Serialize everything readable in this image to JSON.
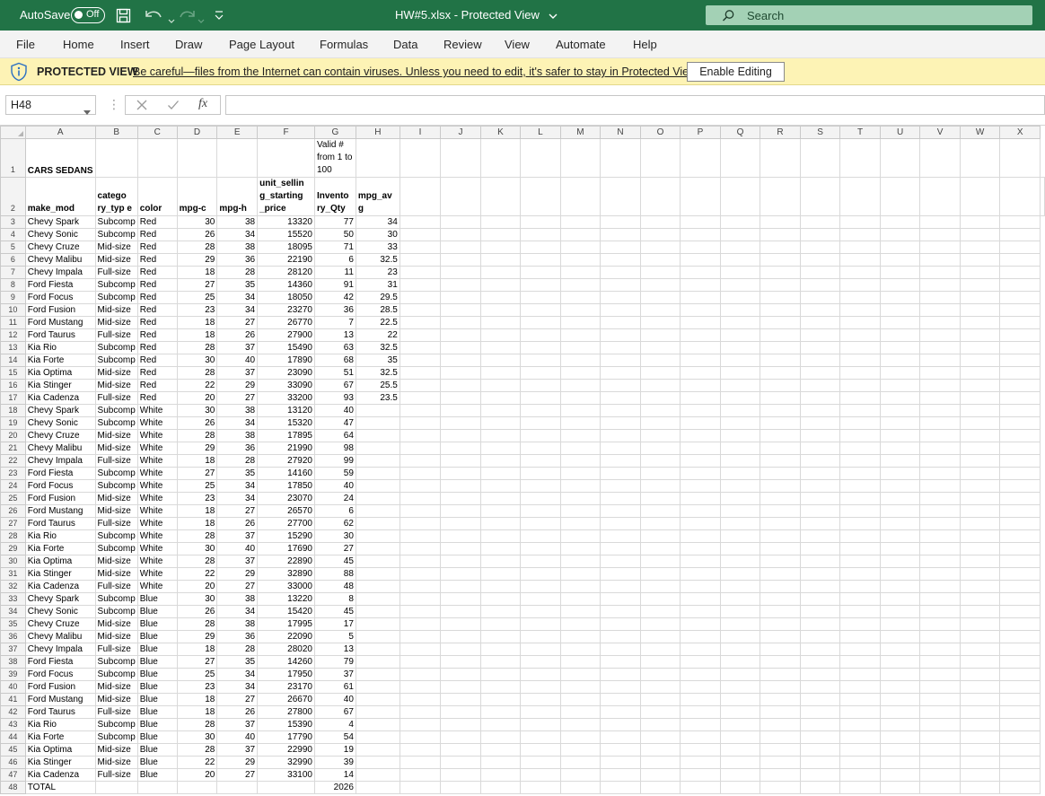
{
  "titlebar": {
    "autosave_label": "AutoSave",
    "autosave_state": "Off",
    "doc_title": "HW#5.xlsx  -  Protected View",
    "search_placeholder": "Search"
  },
  "ribbon": {
    "tabs": [
      "File",
      "Home",
      "Insert",
      "Draw",
      "Page Layout",
      "Formulas",
      "Data",
      "Review",
      "View",
      "Automate",
      "Help"
    ]
  },
  "protected_view": {
    "title": "PROTECTED VIEW",
    "message": "Be careful—files from the Internet can contain viruses. Unless you need to edit, it's safer to stay in Protected View.",
    "button": "Enable Editing"
  },
  "formula_bar": {
    "name_box": "H48",
    "fx_label": "fx",
    "formula": ""
  },
  "grid": {
    "columns": [
      "A",
      "B",
      "C",
      "D",
      "E",
      "F",
      "G",
      "H",
      "I",
      "J",
      "K",
      "L",
      "M",
      "N",
      "O",
      "P",
      "Q",
      "R",
      "S",
      "T",
      "U",
      "V",
      "W",
      "X"
    ],
    "row1": {
      "num": "1",
      "a": "CARS SEDANS",
      "g": "Valid # from 1 to 100"
    },
    "row2": {
      "num": "2",
      "cells": [
        "make_mod",
        "catego ry_typ e",
        "color",
        "mpg-c",
        "mpg-h",
        "unit_sellin g_starting _price",
        "Invento ry_Qty",
        "mpg_av g"
      ]
    },
    "rows": [
      {
        "num": "3",
        "make": "Chevy Spark",
        "cat": "Subcomp",
        "color": "Red",
        "mpgc": "30",
        "mpgh": "38",
        "price": "13320",
        "qty": "77",
        "avg": "34"
      },
      {
        "num": "4",
        "make": "Chevy Sonic",
        "cat": "Subcomp",
        "color": "Red",
        "mpgc": "26",
        "mpgh": "34",
        "price": "15520",
        "qty": "50",
        "avg": "30"
      },
      {
        "num": "5",
        "make": "Chevy Cruze",
        "cat": "Mid-size",
        "color": "Red",
        "mpgc": "28",
        "mpgh": "38",
        "price": "18095",
        "qty": "71",
        "avg": "33"
      },
      {
        "num": "6",
        "make": "Chevy Malibu",
        "cat": "Mid-size",
        "color": "Red",
        "mpgc": "29",
        "mpgh": "36",
        "price": "22190",
        "qty": "6",
        "avg": "32.5"
      },
      {
        "num": "7",
        "make": "Chevy Impala",
        "cat": "Full-size",
        "color": "Red",
        "mpgc": "18",
        "mpgh": "28",
        "price": "28120",
        "qty": "11",
        "avg": "23"
      },
      {
        "num": "8",
        "make": "Ford Fiesta",
        "cat": "Subcomp",
        "color": "Red",
        "mpgc": "27",
        "mpgh": "35",
        "price": "14360",
        "qty": "91",
        "avg": "31"
      },
      {
        "num": "9",
        "make": "Ford Focus",
        "cat": "Subcomp",
        "color": "Red",
        "mpgc": "25",
        "mpgh": "34",
        "price": "18050",
        "qty": "42",
        "avg": "29.5"
      },
      {
        "num": "10",
        "make": "Ford Fusion",
        "cat": "Mid-size",
        "color": "Red",
        "mpgc": "23",
        "mpgh": "34",
        "price": "23270",
        "qty": "36",
        "avg": "28.5"
      },
      {
        "num": "11",
        "make": "Ford Mustang",
        "cat": "Mid-size",
        "color": "Red",
        "mpgc": "18",
        "mpgh": "27",
        "price": "26770",
        "qty": "7",
        "avg": "22.5"
      },
      {
        "num": "12",
        "make": "Ford Taurus",
        "cat": "Full-size",
        "color": "Red",
        "mpgc": "18",
        "mpgh": "26",
        "price": "27900",
        "qty": "13",
        "avg": "22"
      },
      {
        "num": "13",
        "make": "Kia Rio",
        "cat": "Subcomp",
        "color": "Red",
        "mpgc": "28",
        "mpgh": "37",
        "price": "15490",
        "qty": "63",
        "avg": "32.5"
      },
      {
        "num": "14",
        "make": "Kia Forte",
        "cat": "Subcomp",
        "color": "Red",
        "mpgc": "30",
        "mpgh": "40",
        "price": "17890",
        "qty": "68",
        "avg": "35"
      },
      {
        "num": "15",
        "make": "Kia Optima",
        "cat": "Mid-size",
        "color": "Red",
        "mpgc": "28",
        "mpgh": "37",
        "price": "23090",
        "qty": "51",
        "avg": "32.5"
      },
      {
        "num": "16",
        "make": "Kia Stinger",
        "cat": "Mid-size",
        "color": "Red",
        "mpgc": "22",
        "mpgh": "29",
        "price": "33090",
        "qty": "67",
        "avg": "25.5"
      },
      {
        "num": "17",
        "make": "Kia Cadenza",
        "cat": "Full-size",
        "color": "Red",
        "mpgc": "20",
        "mpgh": "27",
        "price": "33200",
        "qty": "93",
        "avg": "23.5"
      },
      {
        "num": "18",
        "make": "Chevy Spark",
        "cat": "Subcomp",
        "color": "White",
        "mpgc": "30",
        "mpgh": "38",
        "price": "13120",
        "qty": "40",
        "avg": ""
      },
      {
        "num": "19",
        "make": "Chevy Sonic",
        "cat": "Subcomp",
        "color": "White",
        "mpgc": "26",
        "mpgh": "34",
        "price": "15320",
        "qty": "47",
        "avg": ""
      },
      {
        "num": "20",
        "make": "Chevy Cruze",
        "cat": "Mid-size",
        "color": "White",
        "mpgc": "28",
        "mpgh": "38",
        "price": "17895",
        "qty": "64",
        "avg": ""
      },
      {
        "num": "21",
        "make": "Chevy Malibu",
        "cat": "Mid-size",
        "color": "White",
        "mpgc": "29",
        "mpgh": "36",
        "price": "21990",
        "qty": "98",
        "avg": ""
      },
      {
        "num": "22",
        "make": "Chevy Impala",
        "cat": "Full-size",
        "color": "White",
        "mpgc": "18",
        "mpgh": "28",
        "price": "27920",
        "qty": "99",
        "avg": ""
      },
      {
        "num": "23",
        "make": "Ford Fiesta",
        "cat": "Subcomp",
        "color": "White",
        "mpgc": "27",
        "mpgh": "35",
        "price": "14160",
        "qty": "59",
        "avg": ""
      },
      {
        "num": "24",
        "make": "Ford Focus",
        "cat": "Subcomp",
        "color": "White",
        "mpgc": "25",
        "mpgh": "34",
        "price": "17850",
        "qty": "40",
        "avg": ""
      },
      {
        "num": "25",
        "make": "Ford Fusion",
        "cat": "Mid-size",
        "color": "White",
        "mpgc": "23",
        "mpgh": "34",
        "price": "23070",
        "qty": "24",
        "avg": ""
      },
      {
        "num": "26",
        "make": "Ford Mustang",
        "cat": "Mid-size",
        "color": "White",
        "mpgc": "18",
        "mpgh": "27",
        "price": "26570",
        "qty": "6",
        "avg": ""
      },
      {
        "num": "27",
        "make": "Ford Taurus",
        "cat": "Full-size",
        "color": "White",
        "mpgc": "18",
        "mpgh": "26",
        "price": "27700",
        "qty": "62",
        "avg": ""
      },
      {
        "num": "28",
        "make": "Kia Rio",
        "cat": "Subcomp",
        "color": "White",
        "mpgc": "28",
        "mpgh": "37",
        "price": "15290",
        "qty": "30",
        "avg": ""
      },
      {
        "num": "29",
        "make": "Kia Forte",
        "cat": "Subcomp",
        "color": "White",
        "mpgc": "30",
        "mpgh": "40",
        "price": "17690",
        "qty": "27",
        "avg": ""
      },
      {
        "num": "30",
        "make": "Kia Optima",
        "cat": "Mid-size",
        "color": "White",
        "mpgc": "28",
        "mpgh": "37",
        "price": "22890",
        "qty": "45",
        "avg": ""
      },
      {
        "num": "31",
        "make": "Kia Stinger",
        "cat": "Mid-size",
        "color": "White",
        "mpgc": "22",
        "mpgh": "29",
        "price": "32890",
        "qty": "88",
        "avg": ""
      },
      {
        "num": "32",
        "make": "Kia Cadenza",
        "cat": "Full-size",
        "color": "White",
        "mpgc": "20",
        "mpgh": "27",
        "price": "33000",
        "qty": "48",
        "avg": ""
      },
      {
        "num": "33",
        "make": "Chevy Spark",
        "cat": "Subcomp",
        "color": "Blue",
        "mpgc": "30",
        "mpgh": "38",
        "price": "13220",
        "qty": "8",
        "avg": ""
      },
      {
        "num": "34",
        "make": "Chevy Sonic",
        "cat": "Subcomp",
        "color": "Blue",
        "mpgc": "26",
        "mpgh": "34",
        "price": "15420",
        "qty": "45",
        "avg": ""
      },
      {
        "num": "35",
        "make": "Chevy Cruze",
        "cat": "Mid-size",
        "color": "Blue",
        "mpgc": "28",
        "mpgh": "38",
        "price": "17995",
        "qty": "17",
        "avg": ""
      },
      {
        "num": "36",
        "make": "Chevy Malibu",
        "cat": "Mid-size",
        "color": "Blue",
        "mpgc": "29",
        "mpgh": "36",
        "price": "22090",
        "qty": "5",
        "avg": ""
      },
      {
        "num": "37",
        "make": "Chevy Impala",
        "cat": "Full-size",
        "color": "Blue",
        "mpgc": "18",
        "mpgh": "28",
        "price": "28020",
        "qty": "13",
        "avg": ""
      },
      {
        "num": "38",
        "make": "Ford Fiesta",
        "cat": "Subcomp",
        "color": "Blue",
        "mpgc": "27",
        "mpgh": "35",
        "price": "14260",
        "qty": "79",
        "avg": ""
      },
      {
        "num": "39",
        "make": "Ford Focus",
        "cat": "Subcomp",
        "color": "Blue",
        "mpgc": "25",
        "mpgh": "34",
        "price": "17950",
        "qty": "37",
        "avg": ""
      },
      {
        "num": "40",
        "make": "Ford Fusion",
        "cat": "Mid-size",
        "color": "Blue",
        "mpgc": "23",
        "mpgh": "34",
        "price": "23170",
        "qty": "61",
        "avg": ""
      },
      {
        "num": "41",
        "make": "Ford Mustang",
        "cat": "Mid-size",
        "color": "Blue",
        "mpgc": "18",
        "mpgh": "27",
        "price": "26670",
        "qty": "40",
        "avg": ""
      },
      {
        "num": "42",
        "make": "Ford Taurus",
        "cat": "Full-size",
        "color": "Blue",
        "mpgc": "18",
        "mpgh": "26",
        "price": "27800",
        "qty": "67",
        "avg": ""
      },
      {
        "num": "43",
        "make": "Kia Rio",
        "cat": "Subcomp",
        "color": "Blue",
        "mpgc": "28",
        "mpgh": "37",
        "price": "15390",
        "qty": "4",
        "avg": ""
      },
      {
        "num": "44",
        "make": "Kia Forte",
        "cat": "Subcomp",
        "color": "Blue",
        "mpgc": "30",
        "mpgh": "40",
        "price": "17790",
        "qty": "54",
        "avg": ""
      },
      {
        "num": "45",
        "make": "Kia Optima",
        "cat": "Mid-size",
        "color": "Blue",
        "mpgc": "28",
        "mpgh": "37",
        "price": "22990",
        "qty": "19",
        "avg": ""
      },
      {
        "num": "46",
        "make": "Kia Stinger",
        "cat": "Mid-size",
        "color": "Blue",
        "mpgc": "22",
        "mpgh": "29",
        "price": "32990",
        "qty": "39",
        "avg": ""
      },
      {
        "num": "47",
        "make": "Kia Cadenza",
        "cat": "Full-size",
        "color": "Blue",
        "mpgc": "20",
        "mpgh": "27",
        "price": "33100",
        "qty": "14",
        "avg": ""
      }
    ],
    "total_row": {
      "num": "48",
      "label": "TOTAL",
      "qty": "2026"
    }
  }
}
